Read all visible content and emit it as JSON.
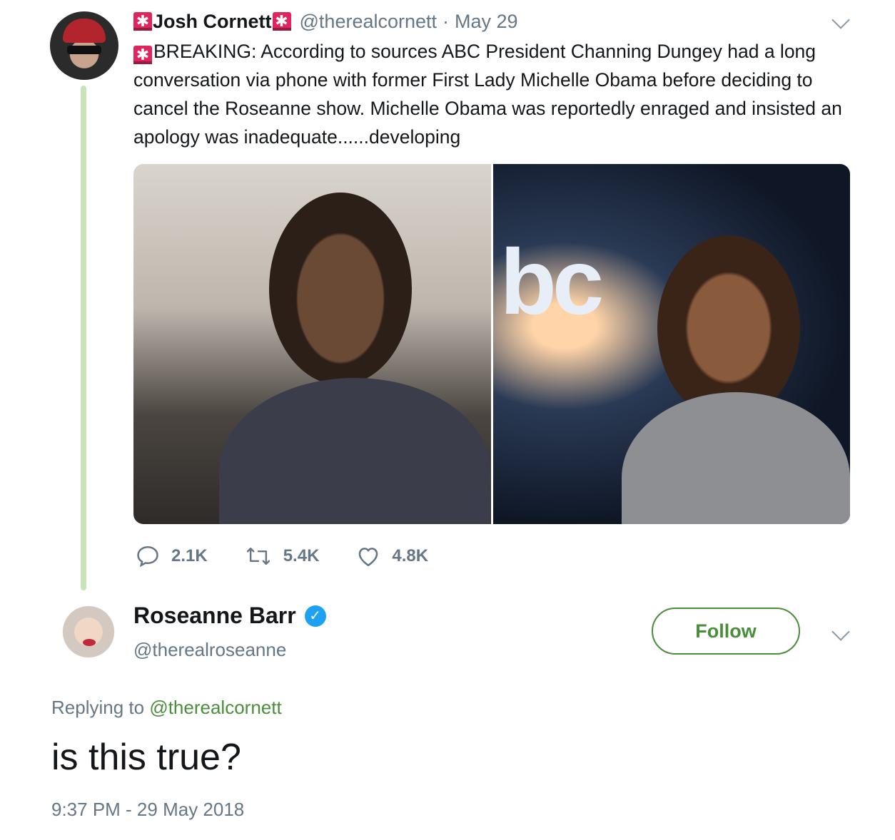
{
  "parent_tweet": {
    "emoji": "🚨",
    "author_name": "Josh Cornett",
    "handle": "@therealcornett",
    "separator": "·",
    "date": "May 29",
    "text": "BREAKING: According to sources ABC President Channing Dungey had a long conversation via phone with former First Lady Michelle Obama before deciding to cancel the Roseanne show. Michelle Obama was reportedly enraged and insisted an apology was inadequate......developing",
    "actions": {
      "replies": "2.1K",
      "retweets": "5.4K",
      "likes": "4.8K"
    },
    "icons": [
      "avatar",
      "siren-icon",
      "chevron-down-icon",
      "reply-icon",
      "retweet-icon",
      "like-icon"
    ]
  },
  "reply_tweet": {
    "author_name": "Roseanne Barr",
    "handle": "@therealroseanne",
    "follow_label": "Follow",
    "replying_prefix": "Replying to",
    "replying_handle": "@therealcornett",
    "text": "is this true?",
    "timestamp": "9:37 PM - 29 May 2018",
    "icons": [
      "verified-icon",
      "chevron-down-icon"
    ]
  },
  "colors": {
    "text": "#14171a",
    "muted": "#657786",
    "accent_green": "#4a8e3a",
    "thread_line": "#c7e4b7",
    "verified_blue": "#1da1f2"
  }
}
